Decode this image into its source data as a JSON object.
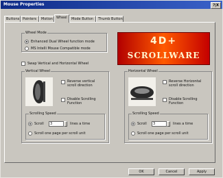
{
  "window": {
    "title": "Mouse Properties",
    "title_buttons": "?|X"
  },
  "tabs": [
    "Buttons",
    "Pointers",
    "Motion",
    "Wheel",
    "Mode Button",
    "Thumb Button"
  ],
  "active_tab": "Wheel",
  "wheel_mode": {
    "title": "Wheel Mode",
    "options": [
      "Enhanced Dual Wheel function mode",
      "MS Intelli Mouse Compatible mode"
    ],
    "selected": 0
  },
  "logo": {
    "line1": "4D+",
    "line2": "SCROLLWARE"
  },
  "swap_label": "Swap Vertical and Horizontal Wheel",
  "vertical": {
    "title": "Vertical Wheel",
    "reverse_label": "Reverse vertical scroll direction",
    "disable_label": "Disable Scrolling Function",
    "speed_title": "Scrolling Speed",
    "scroll_label": "Scroll",
    "scroll_value": "3",
    "lines_label": "lines a time",
    "page_label": "Scroll one page per scroll unit"
  },
  "horizontal": {
    "title": "Horizontal Wheel",
    "reverse_label": "Reverse Horizontal scroll direction",
    "disable_label": "Disable Scrolling Function",
    "speed_title": "Scrolling Speed",
    "scroll_label": "Scroll",
    "scroll_value": "3",
    "lines_label": "lines a time",
    "page_label": "Scroll one page per scroll unit"
  },
  "buttons": {
    "ok": "OK",
    "cancel": "Cancel",
    "apply": "Apply"
  },
  "colors": {
    "title_bar": "#0d2a86",
    "logo_bg": "#d40000",
    "logo_text": "#fff6d0"
  },
  "icons": [
    "vertical-wheel-icon",
    "horizontal-wheel-icon"
  ]
}
